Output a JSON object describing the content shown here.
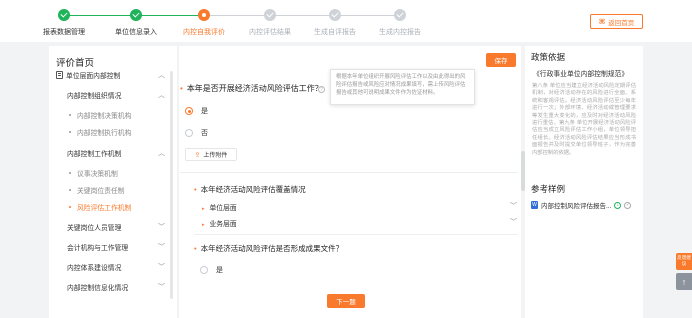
{
  "stepper": {
    "steps": [
      {
        "label": "报表数据管理",
        "state": "done"
      },
      {
        "label": "单位信息录入",
        "state": "done"
      },
      {
        "label": "内控自我评价",
        "state": "current"
      },
      {
        "label": "内控评估结果",
        "state": "todo"
      },
      {
        "label": "生成自评报告",
        "state": "todo"
      },
      {
        "label": "生成内控报告",
        "state": "todo"
      }
    ],
    "home_button": "返回首页"
  },
  "sidebar": {
    "title": "评价首页",
    "items": [
      {
        "label": "单位层面内部控制",
        "level": 1,
        "chevron": "up"
      },
      {
        "label": "内部控制组织情况",
        "level": 2,
        "chevron": "up"
      },
      {
        "label": "内部控制决策机构",
        "level": 3
      },
      {
        "label": "内部控制执行机构",
        "level": 3
      },
      {
        "label": "内部控制工作机制",
        "level": 2,
        "chevron": "up"
      },
      {
        "label": "议事决策机制",
        "level": 3
      },
      {
        "label": "关键岗位责任制",
        "level": 3
      },
      {
        "label": "风险评估工作机制",
        "level": 3,
        "active": true
      },
      {
        "label": "关键岗位人员管理",
        "level": 2,
        "chevron": "down"
      },
      {
        "label": "会计机构与工作管理",
        "level": 2,
        "chevron": "down"
      },
      {
        "label": "内控体系建设情况",
        "level": 2,
        "chevron": "down"
      },
      {
        "label": "内部控制信息化情况",
        "level": 2,
        "chevron": "down"
      }
    ]
  },
  "main": {
    "save_button": "保存",
    "question1": "本年是否开展经济活动风险评估工作？",
    "tooltip": "根据本年单位组织开展风险评估工作以及由此得出的风险评估报告或风险应对情况成果填写，需上传风险评估报告或其他可说明成果文件作为佐证材料。",
    "options1": [
      {
        "label": "是",
        "selected": true
      },
      {
        "label": "否",
        "selected": false
      }
    ],
    "upload_button": "上传附件",
    "section2": "本年经济活动风险评估覆盖情况",
    "subsections": [
      "单位层面",
      "业务层面"
    ],
    "question3": "本年经济活动风险评估是否形成成果文件？",
    "options3": [
      {
        "label": "是",
        "selected": false
      }
    ],
    "next_button": "下一题"
  },
  "right": {
    "title": "政策依据",
    "doc_title": "《行政事业单位内部控制规范》",
    "body": "第八条 单位应当建立经济活动风险定期评估机制，对经济活动存在的风险进行全面、系统和客观评估。经济活动风险评估至少每年进行一次；外部环境、经济活动或管理要求等发生重大变化的，应及时对经济活动风险进行重估。第九条 单位开展经济活动风险评估应当成立风险评估工作小组，单位领导担任组长。经济活动风险评估结果应当形成书面报告并及时提交单位领导班子，作为完善内部控制的依据。",
    "examples_title": "参考样例",
    "example_file": "内部控制风险评估报告..."
  },
  "floating": {
    "feedback": "反馈建议",
    "back_to_top": "↑"
  },
  "colors": {
    "accent": "#f97a2c",
    "done": "#1fb35a",
    "todo": "#cfd3d8"
  }
}
